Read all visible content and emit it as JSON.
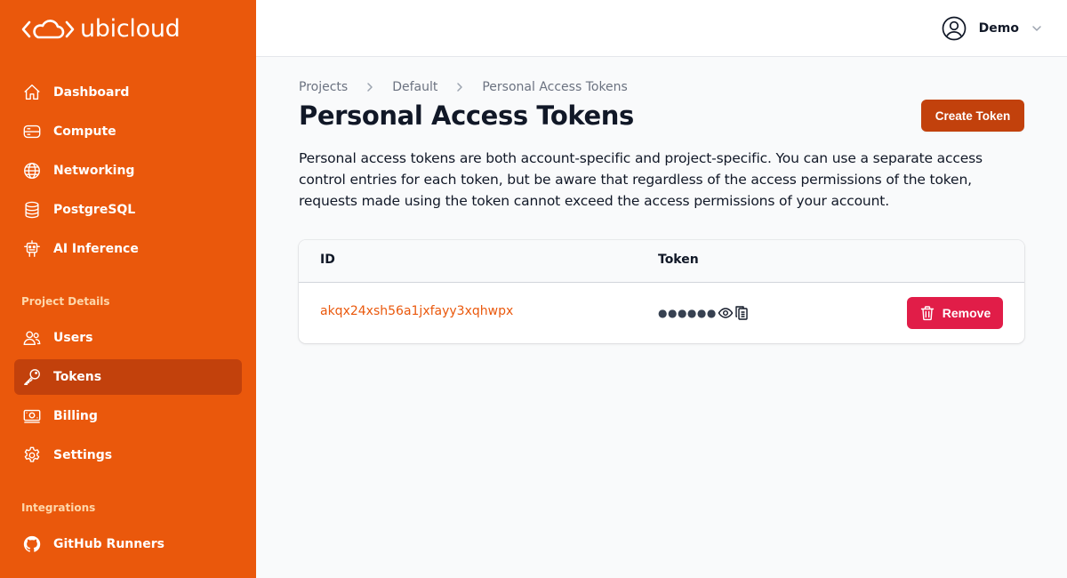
{
  "brand": {
    "name": "ubicloud"
  },
  "sidebar": {
    "items": [
      {
        "label": "Dashboard",
        "icon": "home-icon"
      },
      {
        "label": "Compute",
        "icon": "server-icon"
      },
      {
        "label": "Networking",
        "icon": "globe-icon"
      },
      {
        "label": "PostgreSQL",
        "icon": "database-icon"
      },
      {
        "label": "AI Inference",
        "icon": "robot-icon"
      }
    ],
    "project_section": "Project Details",
    "project_items": [
      {
        "label": "Users",
        "icon": "users-icon"
      },
      {
        "label": "Tokens",
        "icon": "key-icon",
        "active": true
      },
      {
        "label": "Billing",
        "icon": "banknotes-icon"
      },
      {
        "label": "Settings",
        "icon": "gear-icon"
      }
    ],
    "integrations_section": "Integrations",
    "integration_items": [
      {
        "label": "GitHub Runners",
        "icon": "github-icon"
      }
    ]
  },
  "header": {
    "user_name": "Demo"
  },
  "breadcrumb": [
    "Projects",
    "Default",
    "Personal Access Tokens"
  ],
  "page": {
    "title": "Personal Access Tokens",
    "create_button": "Create Token",
    "description": "Personal access tokens are both account-specific and project-specific. You can use a separate access control entries for each token, but be aware that regardless of the access permissions of the token, requests made using the token cannot exceed the access permissions of your account."
  },
  "table": {
    "headers": [
      "ID",
      "Token"
    ],
    "rows": [
      {
        "id": "akqx24xsh56a1jxfayy3xqhwpx",
        "token_masked": "●●●●●●",
        "remove_label": "Remove"
      }
    ]
  },
  "colors": {
    "brand_orange": "#ea580c",
    "active_item": "#c2410c",
    "danger": "#e11d48"
  }
}
